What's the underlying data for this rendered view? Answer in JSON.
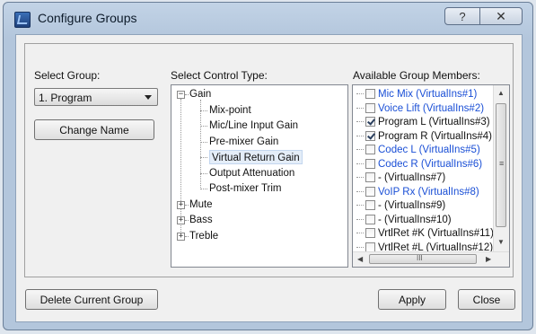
{
  "window": {
    "title": "Configure Groups",
    "help_glyph": "?",
    "close_glyph": "✕"
  },
  "select_group": {
    "label": "Select Group:",
    "value": "1. Program"
  },
  "change_name_label": "Change Name",
  "control_type": {
    "label": "Select Control Type:",
    "tree": [
      {
        "label": "Gain",
        "expanded": true,
        "children": [
          "Mix-point",
          "Mic/Line Input Gain",
          "Pre-mixer Gain",
          "Virtual Return Gain",
          "Output Attenuation",
          "Post-mixer Trim"
        ],
        "selected_child": 3
      },
      {
        "label": "Mute",
        "expanded": false
      },
      {
        "label": "Bass",
        "expanded": false
      },
      {
        "label": "Treble",
        "expanded": false
      }
    ],
    "expanded_glyph": "−",
    "collapsed_glyph": "+"
  },
  "members": {
    "label": "Available Group Members:",
    "items": [
      {
        "label": "Mic Mix (VirtualIns#1)",
        "checked": false,
        "blue": true
      },
      {
        "label": "Voice Lift (VirtualIns#2)",
        "checked": false,
        "blue": true
      },
      {
        "label": "Program L (VirtualIns#3)",
        "checked": true,
        "blue": false
      },
      {
        "label": "Program R (VirtualIns#4)",
        "checked": true,
        "blue": false
      },
      {
        "label": "Codec L (VirtualIns#5)",
        "checked": false,
        "blue": true
      },
      {
        "label": "Codec R (VirtualIns#6)",
        "checked": false,
        "blue": true
      },
      {
        "label": "- (VirtualIns#7)",
        "checked": false,
        "blue": false
      },
      {
        "label": "VoIP Rx (VirtualIns#8)",
        "checked": false,
        "blue": true
      },
      {
        "label": "- (VirtualIns#9)",
        "checked": false,
        "blue": false
      },
      {
        "label": "- (VirtualIns#10)",
        "checked": false,
        "blue": false
      },
      {
        "label": "VrtlRet #K (VirtualIns#11)",
        "checked": false,
        "blue": false
      },
      {
        "label": "VrtlRet #L (VirtualIns#12)",
        "checked": false,
        "blue": false
      }
    ],
    "scroll_grip": "≡",
    "hscroll_grip": "III"
  },
  "buttons": {
    "delete": "Delete Current Group",
    "apply": "Apply",
    "close": "Close"
  },
  "colors": {
    "member_blue": "#1a4fd6",
    "title_bar": "#b3c6dc"
  }
}
